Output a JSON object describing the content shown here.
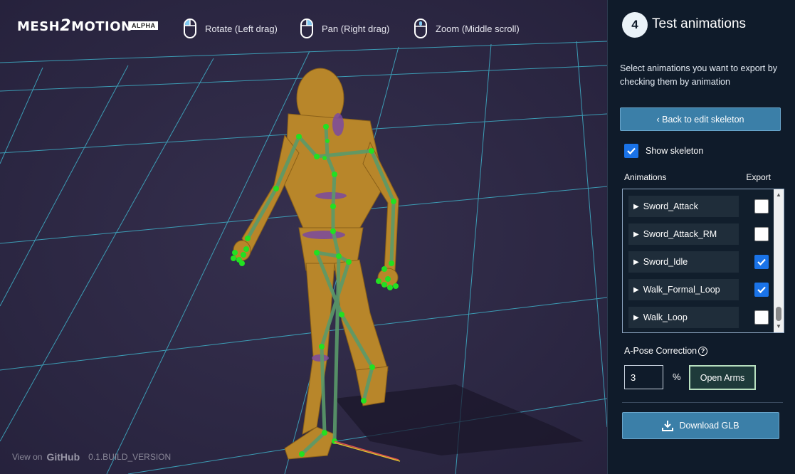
{
  "app": {
    "logo_text": "MESH2MOTION",
    "logo_prefix": "MESH",
    "logo_two": "2",
    "logo_suffix": "MOTION",
    "badge": "ALPHA"
  },
  "hints": [
    {
      "label": "Rotate (Left drag)",
      "icon": "mouse-left-icon"
    },
    {
      "label": "Pan (Right drag)",
      "icon": "mouse-right-icon"
    },
    {
      "label": "Zoom (Middle scroll)",
      "icon": "mouse-middle-icon"
    }
  ],
  "footer": {
    "view_on": "View on",
    "github": "GitHub",
    "version": "0.1.BUILD_VERSION"
  },
  "panel": {
    "step_number": "4",
    "step_title": "Test animations",
    "description": "Select animations you want to export by checking them by animation",
    "back_button": "‹ Back to edit skeleton",
    "show_skeleton_label": "Show skeleton",
    "show_skeleton_checked": true,
    "animations_header": "Animations",
    "export_header": "Export",
    "animations": [
      {
        "name": "Sword_Attack",
        "checked": false
      },
      {
        "name": "Sword_Attack_RM",
        "checked": false
      },
      {
        "name": "Sword_Idle",
        "checked": true
      },
      {
        "name": "Walk_Formal_Loop",
        "checked": true
      },
      {
        "name": "Walk_Loop",
        "checked": false
      }
    ],
    "apose_label": "A-Pose Correction",
    "apose_value": "3",
    "apose_unit": "%",
    "open_arms_button": "Open Arms",
    "download_button": "Download GLB"
  },
  "colors": {
    "accent": "#3b7fa8",
    "grid": "#3fb0c8",
    "bone": "#5a9a6a",
    "joint": "#22e022",
    "mesh": "#b8862a",
    "panel_bg": "#0f1b2a"
  }
}
